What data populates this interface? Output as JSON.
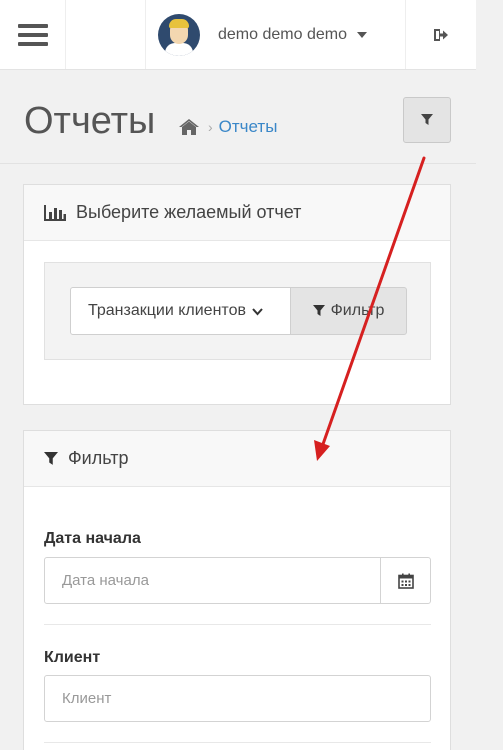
{
  "topbar": {
    "menu_icon": "hamburger-icon",
    "username": "demo demo demo",
    "logout_icon": "sign-out-icon"
  },
  "header": {
    "title": "Отчеты",
    "home_icon": "home-icon",
    "breadcrumb_sep": "›",
    "breadcrumb_current": "Отчеты",
    "filter_toggle_icon": "filter-icon"
  },
  "report_panel": {
    "title": "Выберите желаемый отчет",
    "icon": "bar-chart-icon",
    "select_value": "Транзакции клиентов",
    "filter_button_label": "Фильтр"
  },
  "filter_panel": {
    "title": "Фильтр",
    "icon": "filter-icon",
    "start_date_label": "Дата начала",
    "start_date_placeholder": "Дата начала",
    "calendar_icon": "calendar-icon",
    "client_label": "Клиент",
    "client_placeholder": "Клиент"
  },
  "annotation": {
    "arrow_color": "#d62020"
  }
}
